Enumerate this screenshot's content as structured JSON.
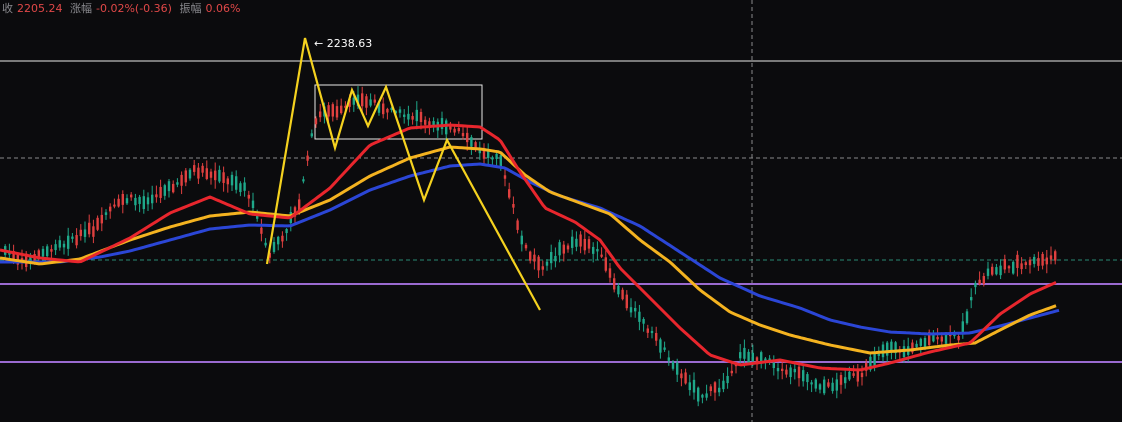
{
  "info_bar": {
    "close_label": "收",
    "close_value": "2205.24",
    "change_label": "涨幅",
    "change_value": "-0.02%(-0.36)",
    "amplitude_label": "振幅",
    "amplitude_value": "0.06%"
  },
  "chart_data": {
    "type": "candlestick",
    "annotations": [
      {
        "text": "← 2238.63"
      }
    ],
    "colors": {
      "background": "#0b0b0d",
      "up": "#1fa88a",
      "down": "#e0403f",
      "ma_red": "#e8262d",
      "ma_orange": "#f4b320",
      "ma_blue": "#2b46d6",
      "pattern": "#f5d21f",
      "purple_line": "#9a6ad0",
      "white_line": "#e8e8e8",
      "dash_line": "#8a8a8a",
      "green_dash": "#2a8a72"
    }
  }
}
